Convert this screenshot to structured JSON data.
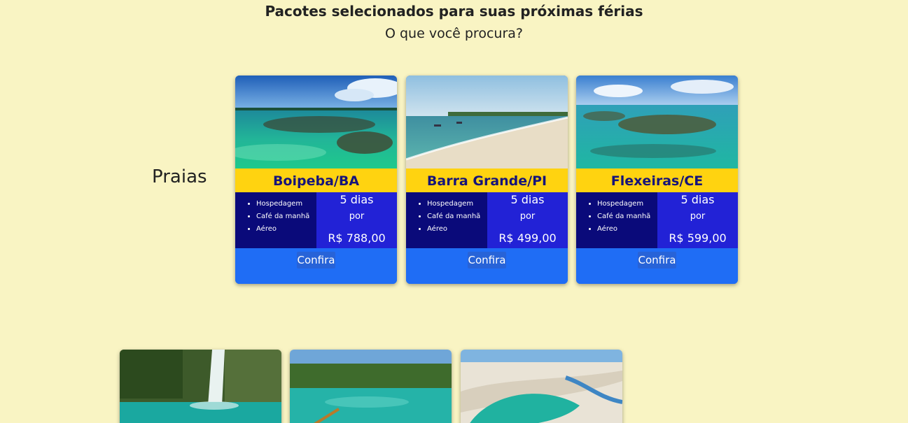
{
  "header": {
    "title": "Pacotes selecionados para suas próximas férias",
    "subtitle": "O que você procura?"
  },
  "section": {
    "label": "Praias"
  },
  "cards": [
    {
      "name": "Boipeba/BA",
      "features": [
        "Hospedagem",
        "Café da manhã",
        "Aéreo"
      ],
      "days": "5 dias",
      "por": "por",
      "price": "R$ 788,00",
      "button": "Confira"
    },
    {
      "name": "Barra Grande/PI",
      "features": [
        "Hospedagem",
        "Café da manhã",
        "Aéreo"
      ],
      "days": "5 dias",
      "por": "por",
      "price": "R$ 499,00",
      "button": "Confira"
    },
    {
      "name": "Flexeiras/CE",
      "features": [
        "Hospedagem",
        "Café da manhã",
        "Aéreo"
      ],
      "days": "5 dias",
      "por": "por",
      "price": "R$ 599,00",
      "button": "Confira"
    }
  ],
  "colors": {
    "background": "#f9f4c3",
    "name_band": "#ffd310",
    "name_text": "#16147a",
    "features_bg": "#0a0a7a",
    "price_bg": "#2222d6",
    "footer_bg": "#1f6df5"
  }
}
